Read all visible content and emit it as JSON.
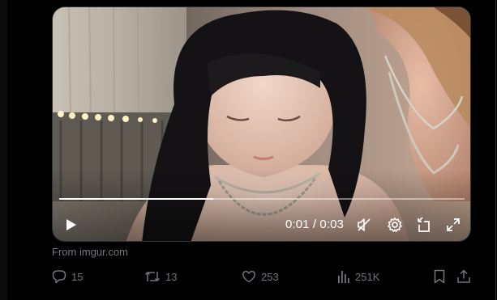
{
  "video": {
    "progress_fraction": 0.38,
    "time_display": "0:01 / 0:03"
  },
  "controls": {
    "play_icon": "play-icon",
    "mute_icon": "volume-muted-icon",
    "settings_icon": "gear-icon",
    "dock_icon": "picture-in-picture-icon",
    "fullscreen_icon": "fullscreen-icon"
  },
  "source": {
    "label": "From imgur.com"
  },
  "actions": {
    "reply_count": "15",
    "repost_count": "13",
    "like_count": "253",
    "views_count": "251K"
  },
  "colors": {
    "background": "#000000",
    "muted_text": "#71767b",
    "border": "#2f3336"
  }
}
